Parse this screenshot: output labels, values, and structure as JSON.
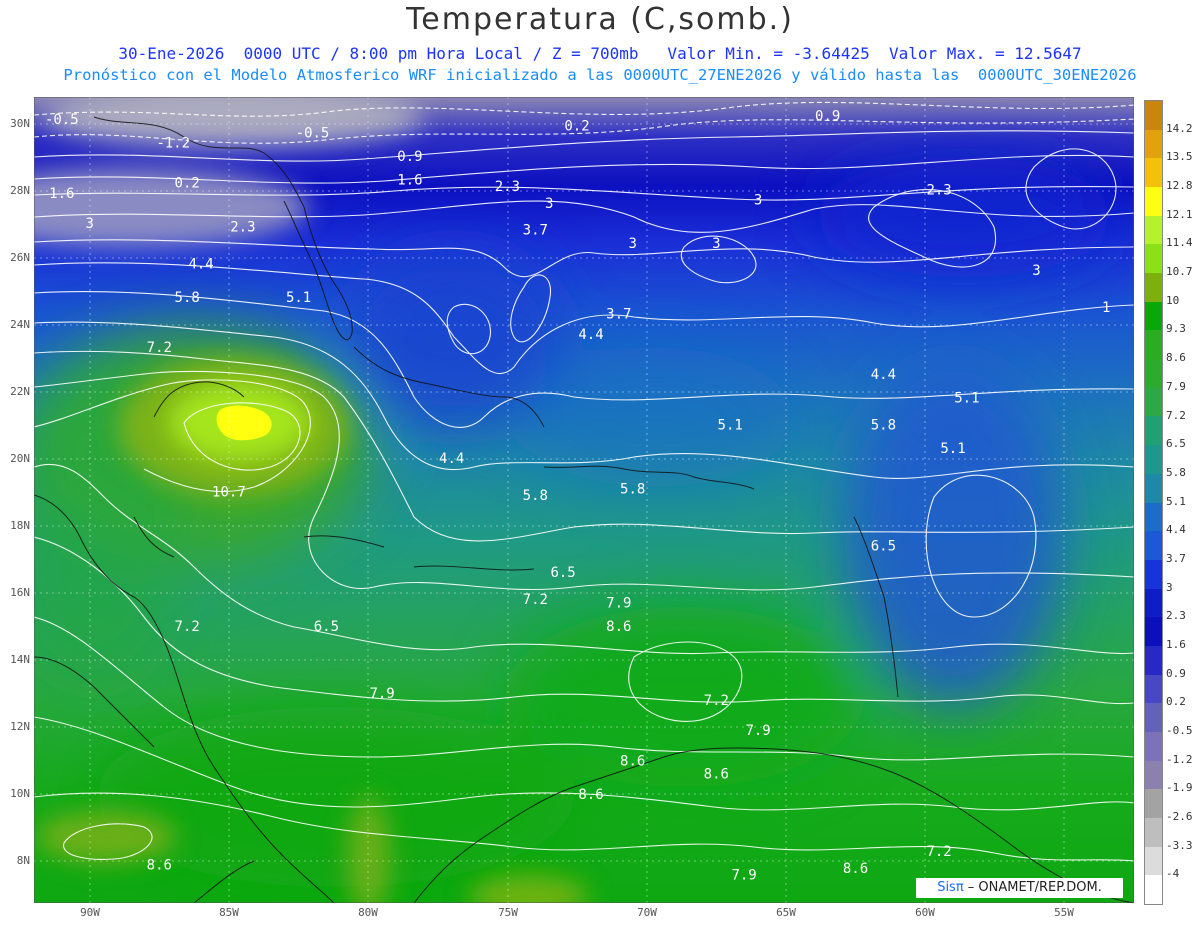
{
  "header": {
    "title": "Temperatura (C,somb.)",
    "line1": "30-Ene-2026  0000 UTC / 8:00 pm Hora Local / Z = 700mb   Valor Min. = -3.64425  Valor Max. = 12.5647",
    "line2": "Pronóstico con el Modelo Atmosferico WRF inicializado a las 0000UTC_27ENE2026 y válido hasta las  0000UTC_30ENE2026"
  },
  "map": {
    "lon_range": [
      -92.0,
      -52.5
    ],
    "lat_range": [
      6.8,
      30.8
    ],
    "grid": true,
    "lat_ticks": [
      "30N",
      "28N",
      "26N",
      "24N",
      "22N",
      "20N",
      "18N",
      "16N",
      "14N",
      "12N",
      "10N",
      "8N"
    ],
    "lon_ticks": [
      "90W",
      "85W",
      "80W",
      "75W",
      "70W",
      "65W",
      "60W",
      "55W"
    ],
    "contour_labels": [
      {
        "text": "-0.5",
        "lon": -91.0,
        "lat": 30.0
      },
      {
        "text": "-1.2",
        "lon": -87.0,
        "lat": 29.3
      },
      {
        "text": "-0.5",
        "lon": -82.0,
        "lat": 29.6
      },
      {
        "text": "0.2",
        "lon": -72.5,
        "lat": 29.8
      },
      {
        "text": "0.9",
        "lon": -63.5,
        "lat": 30.1
      },
      {
        "text": "0.9",
        "lon": -78.5,
        "lat": 28.9
      },
      {
        "text": "1.6",
        "lon": -78.5,
        "lat": 28.2
      },
      {
        "text": "0.2",
        "lon": -86.5,
        "lat": 28.1
      },
      {
        "text": "1.6",
        "lon": -91.0,
        "lat": 27.8
      },
      {
        "text": "2.3",
        "lon": -75.0,
        "lat": 28.0
      },
      {
        "text": "3",
        "lon": -73.5,
        "lat": 27.5
      },
      {
        "text": "3",
        "lon": -66.0,
        "lat": 27.6
      },
      {
        "text": "2.3",
        "lon": -59.5,
        "lat": 27.9
      },
      {
        "text": "3",
        "lon": -90.0,
        "lat": 26.9
      },
      {
        "text": "2.3",
        "lon": -84.5,
        "lat": 26.8
      },
      {
        "text": "3.7",
        "lon": -74.0,
        "lat": 26.7
      },
      {
        "text": "3",
        "lon": -70.5,
        "lat": 26.3
      },
      {
        "text": "3",
        "lon": -67.5,
        "lat": 26.3
      },
      {
        "text": "3",
        "lon": -56.0,
        "lat": 25.5
      },
      {
        "text": "1",
        "lon": -53.5,
        "lat": 24.4
      },
      {
        "text": "4.4",
        "lon": -86.0,
        "lat": 25.7
      },
      {
        "text": "5.8",
        "lon": -86.5,
        "lat": 24.7
      },
      {
        "text": "5.1",
        "lon": -82.5,
        "lat": 24.7
      },
      {
        "text": "3.7",
        "lon": -71.0,
        "lat": 24.2
      },
      {
        "text": "4.4",
        "lon": -72.0,
        "lat": 23.6
      },
      {
        "text": "7.2",
        "lon": -87.5,
        "lat": 23.2
      },
      {
        "text": "4.4",
        "lon": -61.5,
        "lat": 22.4
      },
      {
        "text": "5.1",
        "lon": -58.5,
        "lat": 21.7
      },
      {
        "text": "5.1",
        "lon": -67.0,
        "lat": 20.9
      },
      {
        "text": "5.8",
        "lon": -61.5,
        "lat": 20.9
      },
      {
        "text": "5.1",
        "lon": -59.0,
        "lat": 20.2
      },
      {
        "text": "4.4",
        "lon": -77.0,
        "lat": 19.9
      },
      {
        "text": "10.7",
        "lon": -85.0,
        "lat": 18.9
      },
      {
        "text": "5.8",
        "lon": -74.0,
        "lat": 18.8
      },
      {
        "text": "5.8",
        "lon": -70.5,
        "lat": 19.0
      },
      {
        "text": "6.5",
        "lon": -61.5,
        "lat": 17.3
      },
      {
        "text": "6.5",
        "lon": -73.0,
        "lat": 16.5
      },
      {
        "text": "7.2",
        "lon": -74.0,
        "lat": 15.7
      },
      {
        "text": "7.9",
        "lon": -71.0,
        "lat": 15.6
      },
      {
        "text": "8.6",
        "lon": -71.0,
        "lat": 14.9
      },
      {
        "text": "7.2",
        "lon": -86.5,
        "lat": 14.9
      },
      {
        "text": "6.5",
        "lon": -81.5,
        "lat": 14.9
      },
      {
        "text": "7.9",
        "lon": -79.5,
        "lat": 12.9
      },
      {
        "text": "7.2",
        "lon": -67.5,
        "lat": 12.7
      },
      {
        "text": "7.9",
        "lon": -66.0,
        "lat": 11.8
      },
      {
        "text": "8.6",
        "lon": -70.5,
        "lat": 10.9
      },
      {
        "text": "8.6",
        "lon": -67.5,
        "lat": 10.5
      },
      {
        "text": "8.6",
        "lon": -72.0,
        "lat": 9.9
      },
      {
        "text": "7.2",
        "lon": -59.5,
        "lat": 8.2
      },
      {
        "text": "8.6",
        "lon": -62.5,
        "lat": 7.7
      },
      {
        "text": "7.9",
        "lon": -66.5,
        "lat": 7.5
      },
      {
        "text": "8.6",
        "lon": -87.5,
        "lat": 7.8
      }
    ]
  },
  "colorbar": {
    "levels": [
      "14.2",
      "13.5",
      "12.8",
      "12.1",
      "11.4",
      "10.7",
      "10",
      "9.3",
      "8.6",
      "7.9",
      "7.2",
      "6.5",
      "5.8",
      "5.1",
      "4.4",
      "3.7",
      "3",
      "2.3",
      "1.6",
      "0.9",
      "0.2",
      "-0.5",
      "-1.2",
      "-1.9",
      "-2.6",
      "-3.3",
      "-4"
    ],
    "colors": [
      "#c8870c",
      "#e2a20b",
      "#f4c10a",
      "#fefe12",
      "#b6f22a",
      "#8ce016",
      "#7eb00c",
      "#08a80a",
      "#2bac22",
      "#2cab2e",
      "#2ea846",
      "#21a074",
      "#20978e",
      "#1f87a8",
      "#1c6cc8",
      "#1c58d8",
      "#1734dc",
      "#0d1ec8",
      "#0c0fbe",
      "#2828c8",
      "#4848c4",
      "#6262b8",
      "#7c72b8",
      "#8c80b0",
      "#a3a3a3",
      "#bebebe",
      "#dcdcdc",
      "#ffffff"
    ]
  },
  "credit": {
    "brand": "Sisπ",
    "text": " – ONAMET/REP.DOM."
  }
}
